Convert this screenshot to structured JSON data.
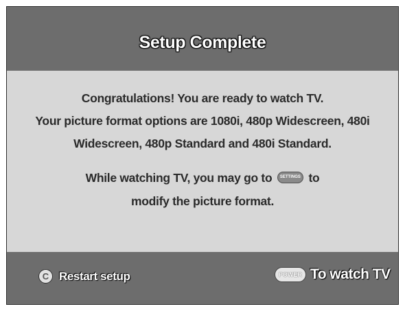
{
  "header": {
    "title": "Setup Complete"
  },
  "message": {
    "line1": "Congratulations! You are ready to watch TV.",
    "line2": "Your picture format options are 1080i, 480p Widescreen, 480i",
    "line3": "Widescreen, 480p Standard and 480i Standard.",
    "line4_before": "While watching TV, you may go to",
    "settings_button_label": "SETTINGS",
    "line4_after": "to",
    "line5": "modify the picture format."
  },
  "footer": {
    "restart": {
      "icon_label": "C",
      "label": "Restart setup"
    },
    "watch": {
      "icon_label": "POWER",
      "label": "To watch TV"
    }
  },
  "colors": {
    "bar": "#6d6d6d",
    "panel": "#d7d7d7",
    "text": "#2a2a2a"
  }
}
